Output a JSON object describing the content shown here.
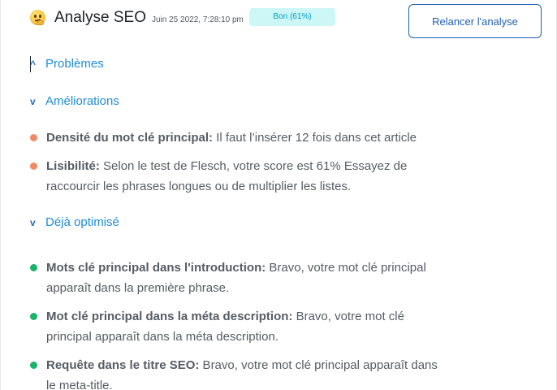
{
  "header": {
    "emoji_icon": "thinking-face-icon",
    "title": "Analyse SEO",
    "timestamp": "Juin 25 2022, 7:28:10 pm",
    "status_badge": "Bon (61%)",
    "rerun_button_label": "Relancer l'analyse"
  },
  "colors": {
    "accent": "#1f8bd8",
    "badge_bg": "#ccf7f6",
    "badge_text": "#00a0c6",
    "improvement_bullet": "#f08a64",
    "good_bullet": "#19b36b"
  },
  "sections": {
    "problems": {
      "chevron": "^",
      "label": "Problèmes"
    },
    "improvements": {
      "chevron": "v",
      "label": "Améliorations",
      "items": [
        {
          "label": "Densité du mot clé principal:",
          "text": " Il faut l’insérer 12 fois dans cet article"
        },
        {
          "label": "Lisibilité:",
          "text": " Selon le test de Flesch, votre score est 61% Essayez de raccourcir les phrases longues ou de multiplier les listes."
        }
      ]
    },
    "optimized": {
      "chevron": "v",
      "label": "Déjà optimisé",
      "items": [
        {
          "label": "Mots clé principal dans l'introduction:",
          "text": " Bravo, votre mot clé principal apparaît dans la première phrase."
        },
        {
          "label": "Mot clé principal dans la méta description:",
          "text": " Bravo, votre mot clé principal apparaît dans la méta description."
        },
        {
          "label": "Requête dans le titre SEO:",
          "text": " Bravo, votre mot clé principal apparaît dans le meta-title."
        }
      ]
    }
  }
}
